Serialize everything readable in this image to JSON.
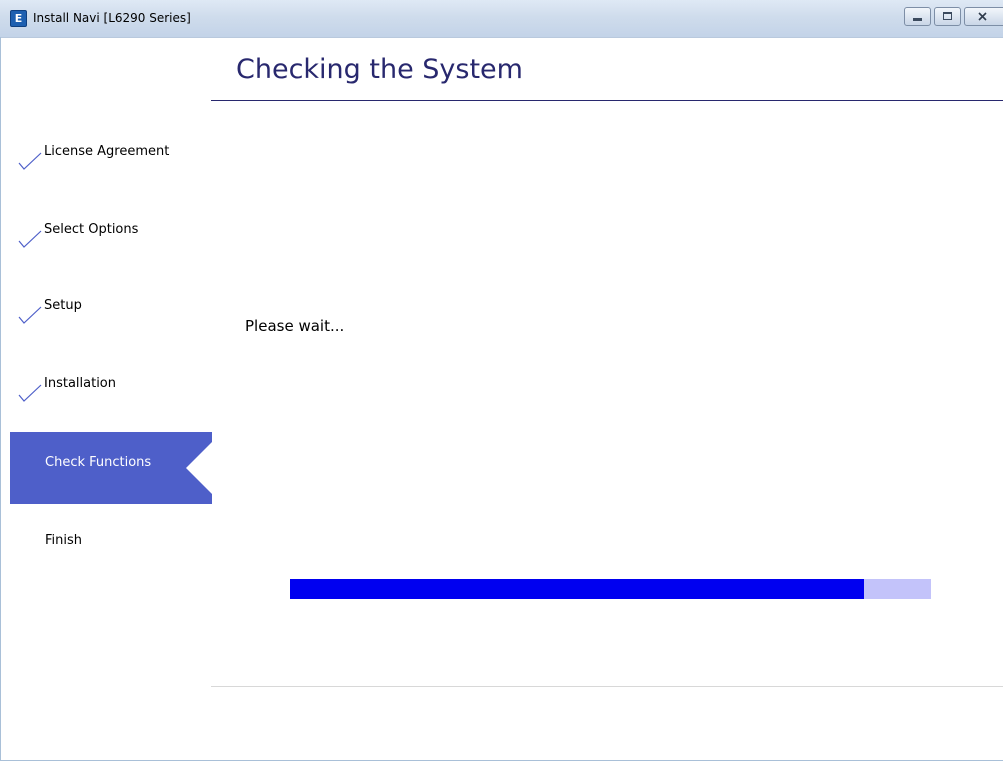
{
  "window": {
    "app_icon_letter": "E",
    "title": "Install Navi [L6290 Series]",
    "controls": {
      "minimize": "minimize",
      "maximize": "maximize",
      "close": "close"
    }
  },
  "header": {
    "title": "Checking the System"
  },
  "sidebar": {
    "steps": [
      {
        "label": "License Agreement",
        "state": "done"
      },
      {
        "label": "Select Options",
        "state": "done"
      },
      {
        "label": "Setup",
        "state": "done"
      },
      {
        "label": "Installation",
        "state": "done"
      },
      {
        "label": "Check Functions",
        "state": "active"
      },
      {
        "label": "Finish",
        "state": "pending"
      }
    ],
    "check_icon": "checkmark-icon",
    "active_color": "#4e5fc9"
  },
  "main": {
    "status": "Please wait...",
    "progress": {
      "fraction": 0.895,
      "fill_color": "#0000f0",
      "track_color": "#c3c3fa"
    }
  },
  "colors": {
    "title": "#28286e"
  }
}
